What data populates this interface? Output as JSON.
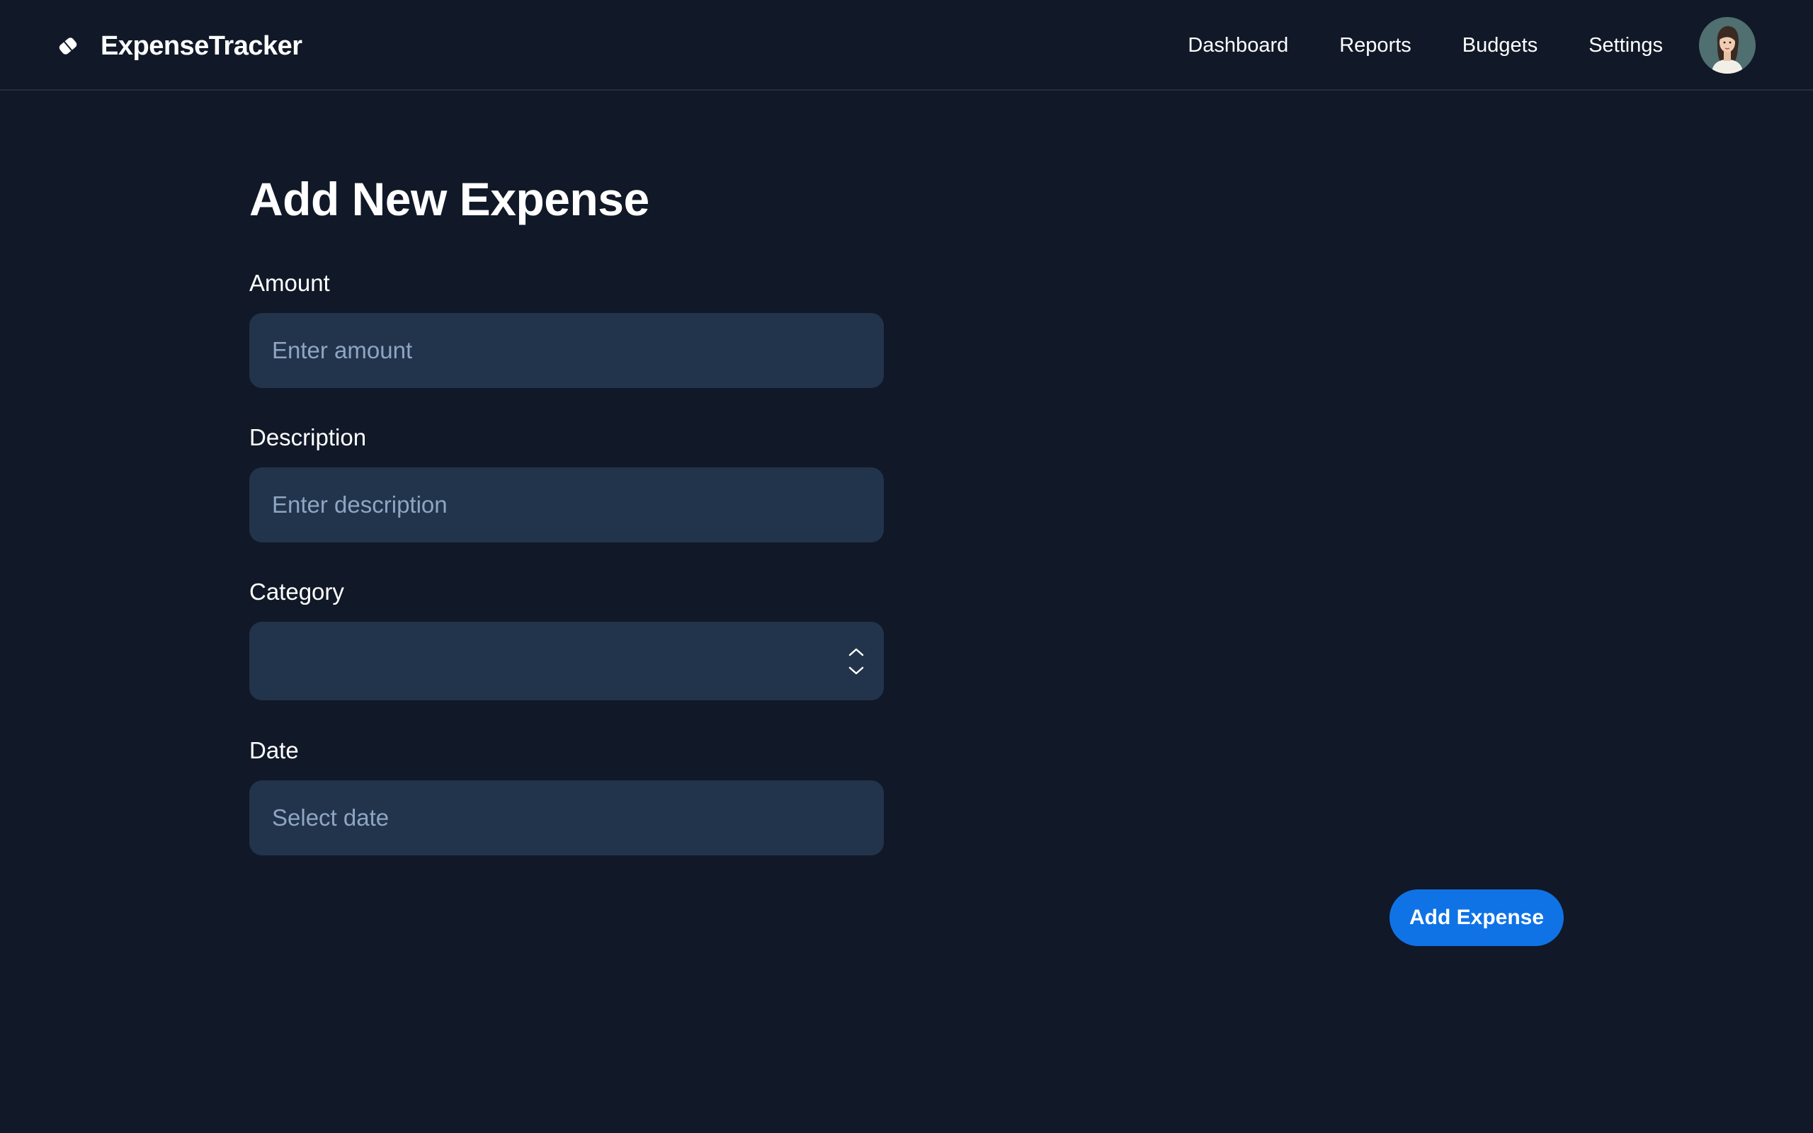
{
  "app": {
    "title": "ExpenseTracker",
    "logo_icon": "ticket-tag-icon"
  },
  "nav": {
    "items": [
      {
        "label": "Dashboard"
      },
      {
        "label": "Reports"
      },
      {
        "label": "Budgets"
      },
      {
        "label": "Settings"
      }
    ],
    "avatar_icon": "user-avatar"
  },
  "form": {
    "title": "Add New Expense",
    "amount": {
      "label": "Amount",
      "placeholder": "Enter amount",
      "value": ""
    },
    "description": {
      "label": "Description",
      "placeholder": "Enter description",
      "value": ""
    },
    "category": {
      "label": "Category",
      "selected": "",
      "icon": "chevron-updown-icon"
    },
    "date": {
      "label": "Date",
      "placeholder": "Select date",
      "value": ""
    },
    "submit_label": "Add Expense"
  },
  "colors": {
    "background": "#111827",
    "field_bg": "#22344b",
    "placeholder": "#8ea5c3",
    "accent": "#0f73e6"
  }
}
